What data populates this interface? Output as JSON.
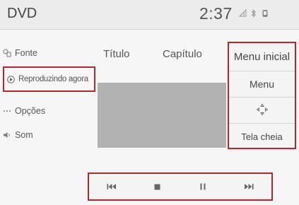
{
  "header": {
    "title": "DVD",
    "clock": "2:37",
    "icons": [
      "signal-icon",
      "bluetooth-icon",
      "phone-icon"
    ]
  },
  "left_menu": {
    "items": [
      {
        "label": "Fonte",
        "icon": "source-icon"
      },
      {
        "label": "Reproduzindo agora",
        "icon": "play-circle-icon"
      },
      {
        "label": "Opções",
        "icon": "options-dots-icon"
      },
      {
        "label": "Som",
        "icon": "speaker-icon"
      }
    ]
  },
  "main": {
    "columns": [
      {
        "label": "Título"
      },
      {
        "label": "Capítulo"
      }
    ]
  },
  "right_menu": {
    "items": [
      {
        "label": "Menu inicial"
      },
      {
        "label": "Menu"
      },
      {
        "label": "",
        "icon": "cursor-arrows-icon"
      },
      {
        "label": "Tela cheia"
      }
    ]
  },
  "controls": {
    "buttons": [
      {
        "icon": "skip-previous-icon"
      },
      {
        "icon": "stop-icon"
      },
      {
        "icon": "pause-icon"
      },
      {
        "icon": "skip-next-icon"
      }
    ]
  },
  "colors": {
    "highlight_border": "#b3262e",
    "video_area": "#b2b2b2",
    "background": "#f6f6f6"
  }
}
